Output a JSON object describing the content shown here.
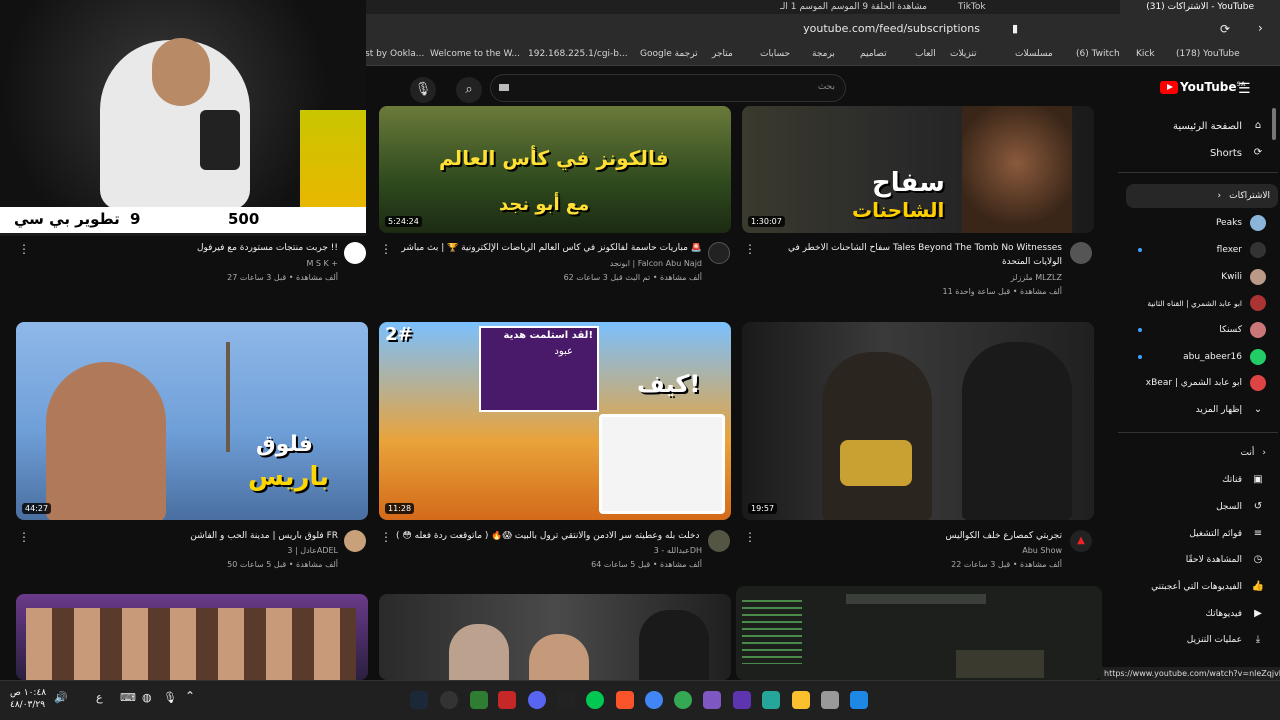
{
  "browser": {
    "tabs": [
      {
        "label": "مشاهدة الحلقة 9 الموسم الموسم 1 الـ"
      },
      {
        "label": "TikTok"
      },
      {
        "label": "(31) الاشتراكات - YouTube"
      }
    ],
    "url": "youtube.com/feed/subscriptions",
    "bookmarks": [
      "st by Ookla...",
      "Welcome to the W...",
      "192.168.225.1/cgi-b...",
      "Google ترجمة",
      "متاجر",
      "حسابات",
      "برمجة",
      "تصاميم",
      "العاب",
      "تنزيلات",
      "مسلسلات",
      "(6) Twitch",
      "Kick",
      "(178) YouTube"
    ]
  },
  "masthead": {
    "search_placeholder": "بحث",
    "logo": "YouTube",
    "logo_country": "SA"
  },
  "sidebar": {
    "home": "الصفحة الرئيسية",
    "shorts": "Shorts",
    "subscriptions": "الاشتراكات",
    "channels": [
      {
        "name": "Peaks",
        "color": "#8ab4d8"
      },
      {
        "name": "flexer",
        "color": "#222",
        "dot": true
      },
      {
        "name": "Kwili",
        "color": "#c98"
      },
      {
        "name": "ابو عابد الشمري | القناه الثانية",
        "color": "#a33"
      },
      {
        "name": "كسنكا",
        "color": "#c77",
        "dot": true
      },
      {
        "name": "abu_abeer16",
        "color": "#2c6",
        "dot": true
      },
      {
        "name": "xBear | ابو عابد الشمري",
        "color": "#d44"
      }
    ],
    "show_more": "إظهار المزيد",
    "you_header": "أنت",
    "you_items": [
      "قناتك",
      "السجل",
      "قوائم التشغيل",
      "المشاهدة لاحقًا",
      "الفيديوهات التي أعجبتني",
      "فيديوهاتك",
      "عمليات التنزيل"
    ]
  },
  "videos": [
    {
      "title": "مباريات حاسمة لفالكونز في كأس العالم الرياضات الإلكترونية 🏆 | بث مباشر 🚨",
      "channel": "ابونجد | Falcon Abu Najd",
      "meta": "62 ألف مشاهدة • تم البث قبل 3 ساعات",
      "duration": "5:24:24",
      "thumb_text": "فالكونز في كأس العالم",
      "thumb_sub": "مع أبو نجد"
    },
    {
      "title": "سفاح الشاحنات الأخطر في Tales Beyond The Tomb No Witnesses",
      "title2": "الولايات المتحدة",
      "channel": "ملززلز MLZLZ",
      "meta": "11 ألف مشاهدة • قبل ساعة واحدة",
      "duration": "1:30:07",
      "thumb_text": "سفاح",
      "thumb_sub": "الشاحنات"
    },
    {
      "title": "جربت منتجات مستوردة مع فيرفول !!",
      "channel": "M S K +",
      "meta": "27 ألف مشاهدة • قبل 3 ساعات",
      "duration": ""
    },
    {
      "title": "فلوق باريس | مدينة الحب و الفاشن FR",
      "channel": "عادل | 3ADEL",
      "meta": "50 ألف مشاهدة • قبل 5 ساعات",
      "duration": "44:27",
      "thumb_text": "فلوق",
      "thumb_sub": "باريس"
    },
    {
      "title": "دخلت بله وعطيته سر الادمن والانتقي ترول بالبيت 😱🔥 ( ماتوقعت ردة فعله 😳 ) !!",
      "channel": "عبدالله - 3DH",
      "meta": "64 ألف مشاهدة • قبل 5 ساعات",
      "duration": "11:28",
      "thumb_text": "كيف!",
      "thumb_sub": "لقد استلمت هدية!",
      "thumb_num": "2#",
      "thumb_name": "عبود"
    },
    {
      "title": "تجربتي كمصارع خلف الكواليس",
      "channel": "Abu Show",
      "meta": "22 ألف مشاهدة • قبل 3 ساعات",
      "duration": "19:57"
    }
  ],
  "webcam_overlay": {
    "left": "تطوير بي سي",
    "mid": "9",
    "right": "500"
  },
  "status_url": "https://www.youtube.com/watch?v=nleZqjvPcUQ",
  "clock": {
    "time": "١٠:٤٨ ص",
    "date": "٤٨/٠٣/٢٩"
  }
}
